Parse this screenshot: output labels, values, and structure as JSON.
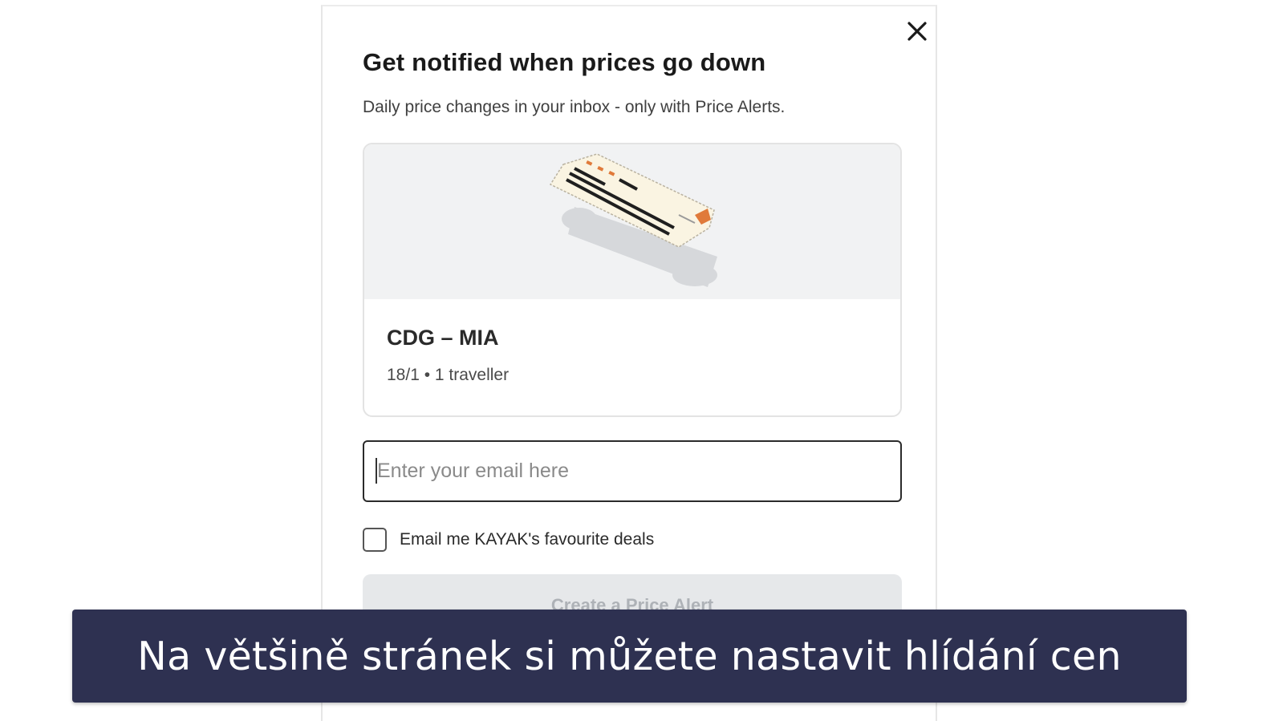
{
  "modal": {
    "title": "Get notified when prices go down",
    "subtitle": "Daily price changes in your inbox - only with Price Alerts.",
    "close_icon": "close-icon"
  },
  "trip": {
    "route": "CDG – MIA",
    "details": "18/1 • 1 traveller",
    "illustration": "boarding-pass-illustration"
  },
  "email": {
    "placeholder": "Enter your email here",
    "value": ""
  },
  "deals_checkbox": {
    "label": "Email me KAYAK's favourite deals",
    "checked": false
  },
  "create_button": {
    "label": "Create a Price Alert",
    "disabled": true
  },
  "caption": {
    "text": "Na většině stránek si můžete nastavit hlídání cen"
  },
  "colors": {
    "banner": "#2e3151",
    "banner_text": "#ffffff",
    "button_disabled_bg": "#e6e8ea",
    "button_disabled_text": "#aeb2b7",
    "ticket_accent": "#e07a3a"
  }
}
